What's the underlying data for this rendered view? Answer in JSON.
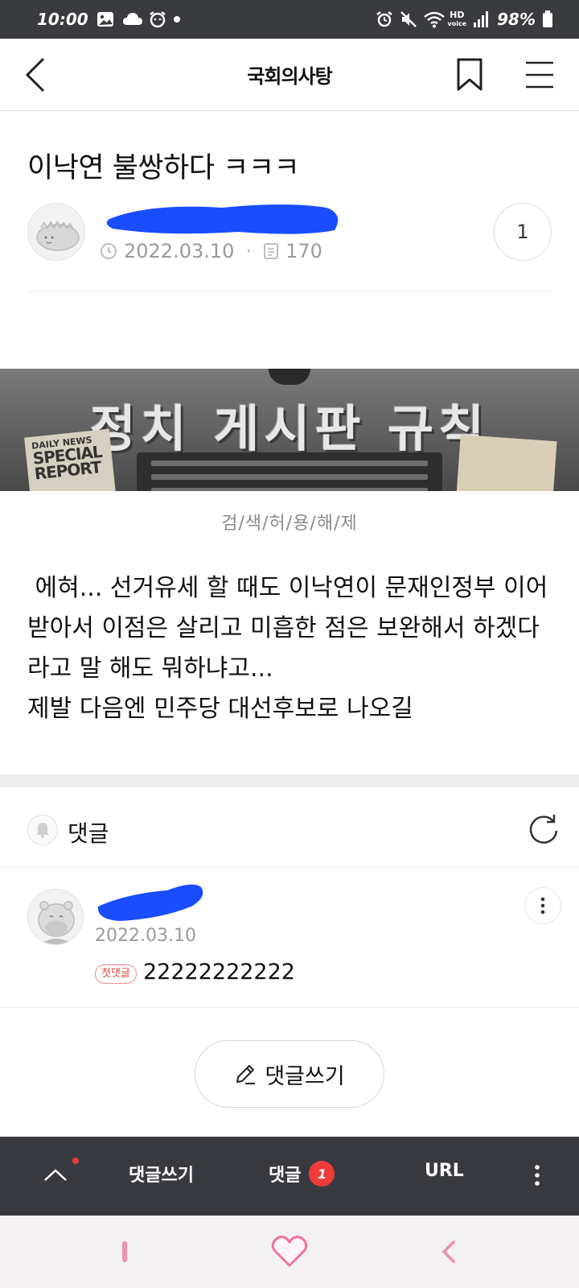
{
  "status_bar": {
    "time": "10:00",
    "battery": "98%",
    "network_badge_top": "HD",
    "network_badge_bottom": "voice"
  },
  "header": {
    "title": "국회의사탕"
  },
  "post": {
    "title": "이낙연 불쌍하다 ㅋㅋㅋ",
    "date": "2022.03.10",
    "views": "170",
    "comment_count": "1",
    "image_caption": "검/색/허/용/해/제",
    "body": " 에혀... 선거유세 할 때도 이낙연이 문재인정부 이어받아서 이점은 살리고 미흡한 점은 보완해서 하겠다라고 말 해도 뭐하냐고...\n제발 다음엔 민주당 대선후보로 나오길"
  },
  "banner": {
    "title": "정치 게시판 규칙",
    "paper_top": "DAILY NEWS",
    "paper_big_1": "SPECIAL",
    "paper_big_2": "REPORT"
  },
  "comments": {
    "label": "댓글",
    "items": [
      {
        "date": "2022.03.10",
        "badge": "첫댓글",
        "text": "22222222222"
      }
    ],
    "write_button": "댓글쓰기"
  },
  "toolbar": {
    "write_label": "댓글쓰기",
    "comments_label": "댓글",
    "comments_badge": "1",
    "url_label": "URL"
  },
  "colors": {
    "status_bar_bg": "#3a3b3e",
    "toolbar_bg": "#393a3f",
    "badge_red": "#f03b3b",
    "redaction_blue": "#1a4dff"
  }
}
